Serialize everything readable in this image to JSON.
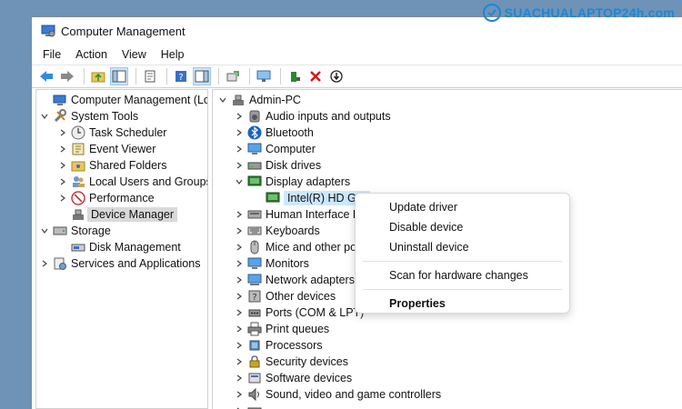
{
  "window": {
    "title": "Computer Management"
  },
  "watermark": {
    "text": "SUACHUALAPTOP24h.com"
  },
  "menu": [
    "File",
    "Action",
    "View",
    "Help"
  ],
  "toolbar": [
    "back-icon",
    "forward-icon",
    "up-folder-icon",
    "show-hide-tree-icon",
    "properties-icon",
    "help-icon",
    "show-hide-action-icon",
    "export-icon",
    "monitor-icon",
    "add-driver-icon",
    "uninstall-icon",
    "update-icon"
  ],
  "left_tree": {
    "root": "Computer Management (Local",
    "system_tools": "System Tools",
    "task_scheduler": "Task Scheduler",
    "event_viewer": "Event Viewer",
    "shared_folders": "Shared Folders",
    "local_users": "Local Users and Groups",
    "performance": "Performance",
    "device_manager": "Device Manager",
    "storage": "Storage",
    "disk_management": "Disk Management",
    "services": "Services and Applications"
  },
  "right_tree": {
    "root": "Admin-PC",
    "items": [
      "Audio inputs and outputs",
      "Bluetooth",
      "Computer",
      "Disk drives",
      "Display adapters",
      "Intel(R) HD Gra",
      "Human Interface D",
      "Keyboards",
      "Mice and other poi",
      "Monitors",
      "Network adapters",
      "Other devices",
      "Ports (COM & LPT)",
      "Print queues",
      "Processors",
      "Security devices",
      "Software devices",
      "Sound, video and game controllers"
    ]
  },
  "context_menu": {
    "update": "Update driver",
    "disable": "Disable device",
    "uninstall": "Uninstall device",
    "scan": "Scan for hardware changes",
    "properties": "Properties"
  }
}
